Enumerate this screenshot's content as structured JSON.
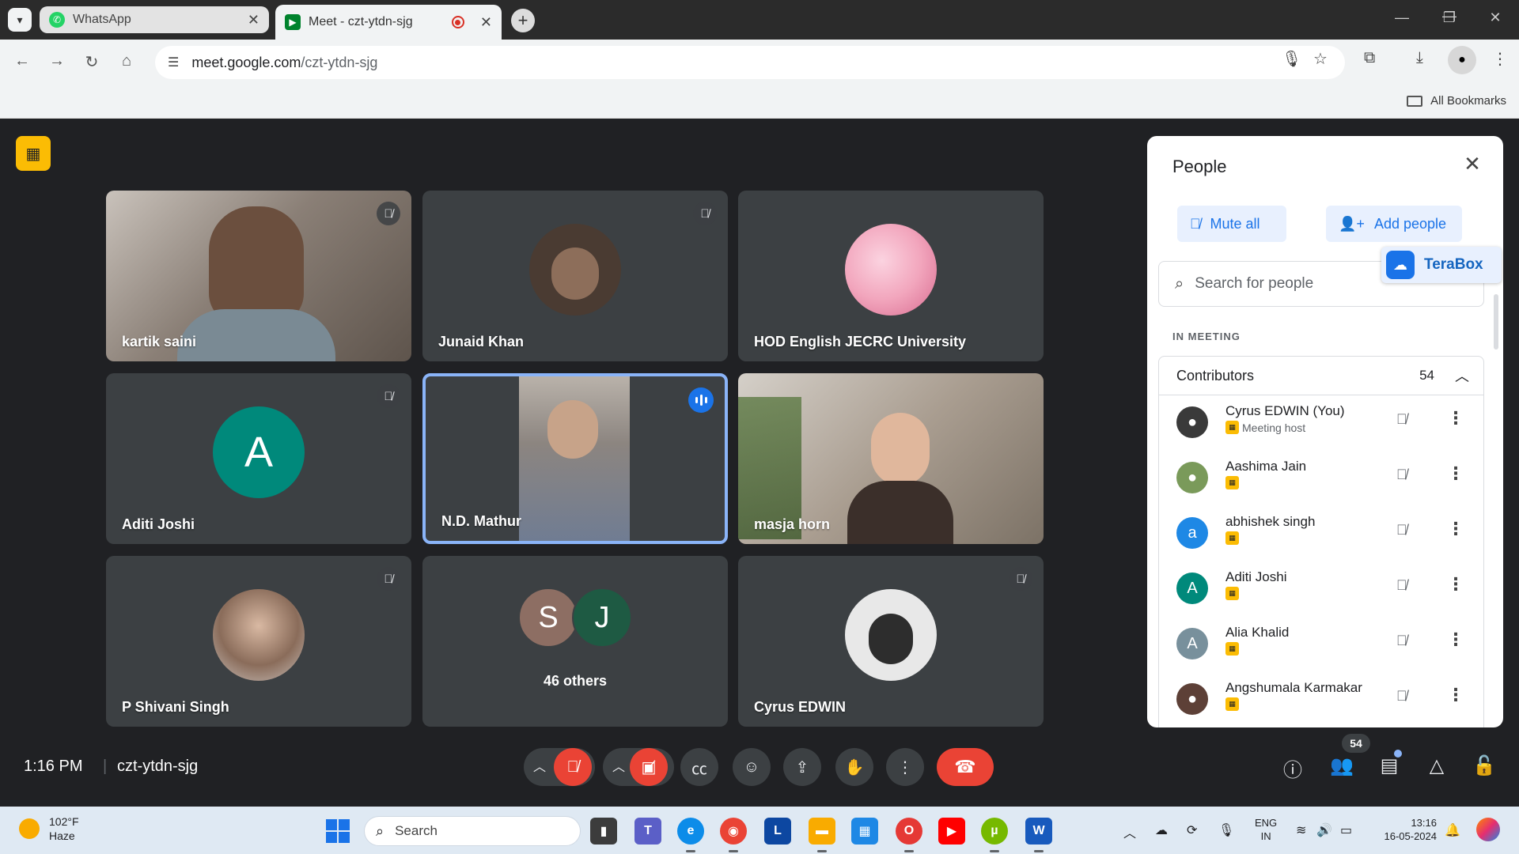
{
  "browser": {
    "tabs": [
      {
        "title": "WhatsApp",
        "active": false,
        "favicon": "whatsapp-icon",
        "color": "#25d366"
      },
      {
        "title": "Meet - czt-ytdn-sjg",
        "active": true,
        "favicon": "meet-icon",
        "color": "#00832d",
        "recording": true
      }
    ],
    "url_host": "meet.google.com",
    "url_path": "/czt-ytdn-sjg",
    "bookmarks_label": "All Bookmarks"
  },
  "tiles": [
    {
      "name": "kartik saini",
      "type": "video",
      "muted": true,
      "bg": "#8a7f76"
    },
    {
      "name": "Junaid Khan",
      "type": "avatar",
      "muted": true,
      "avatar_color": "#4a3b32",
      "avatar_letter": ""
    },
    {
      "name": "HOD English JECRC University",
      "type": "avatar",
      "muted": false,
      "avatar_color": "#f2a6bd",
      "avatar_letter": ""
    },
    {
      "name": "Aditi Joshi",
      "type": "avatar",
      "muted": true,
      "avatar_color": "#00897b",
      "avatar_letter": "A"
    },
    {
      "name": "N.D. Mathur",
      "type": "video",
      "muted": false,
      "speaking": true,
      "bg": "#6f6a66"
    },
    {
      "name": "masja horn",
      "type": "video",
      "muted": false,
      "bg": "#9a8d80"
    },
    {
      "name": "P Shivani Singh",
      "type": "avatar",
      "muted": true,
      "avatar_color": "#c9b6a8",
      "avatar_letter": ""
    },
    {
      "name": "",
      "type": "others",
      "muted": false,
      "others_label": "46 others"
    },
    {
      "name": "Cyrus EDWIN",
      "type": "avatar",
      "muted": true,
      "avatar_color": "#e8e8e8",
      "avatar_letter": ""
    }
  ],
  "others": {
    "label": "46 others",
    "avatars": [
      {
        "letter": "S",
        "color": "#8d6e63"
      },
      {
        "letter": "J",
        "color": "#1e5a43"
      }
    ]
  },
  "people_panel": {
    "title": "People",
    "mute_all_label": "Mute all",
    "add_people_label": "Add people",
    "terabox_label": "TeraBox",
    "search_placeholder": "Search for people",
    "section_label": "IN MEETING",
    "group_label": "Contributors",
    "group_count": "54",
    "participants": [
      {
        "name": "Cyrus EDWIN (You)",
        "role": "Meeting host",
        "avatar_letter": "",
        "avatar_color": "#3a3a3a"
      },
      {
        "name": "Aashima Jain",
        "role": "",
        "avatar_letter": "",
        "avatar_color": "#7a9a5a"
      },
      {
        "name": "abhishek singh",
        "role": "",
        "avatar_letter": "a",
        "avatar_color": "#1e88e5"
      },
      {
        "name": "Aditi Joshi",
        "role": "",
        "avatar_letter": "A",
        "avatar_color": "#00897b"
      },
      {
        "name": "Alia Khalid",
        "role": "",
        "avatar_letter": "A",
        "avatar_color": "#78909c"
      },
      {
        "name": "Angshumala Karmakar",
        "role": "",
        "avatar_letter": "",
        "avatar_color": "#5d4037"
      }
    ]
  },
  "controls": {
    "time": "1:16 PM",
    "separator": "|",
    "meeting_code": "czt-ytdn-sjg",
    "people_count": "54"
  },
  "taskbar": {
    "temperature": "102°F",
    "weather": "Haze",
    "search_label": "Search",
    "lang_line1": "ENG",
    "lang_line2": "IN",
    "clock_time": "13:16",
    "clock_date": "16-05-2024",
    "apps": [
      {
        "icon": "file-explorer-icon",
        "color": "#3c3c3c",
        "glyph": "▮"
      },
      {
        "icon": "teams-icon",
        "color": "#5b5fc7",
        "glyph": "T"
      },
      {
        "icon": "edge-icon",
        "color": "#0c8ce9",
        "glyph": "e"
      },
      {
        "icon": "chrome-icon",
        "color": "#ea4335",
        "glyph": "◉"
      },
      {
        "icon": "l-app-icon",
        "color": "#0d47a1",
        "glyph": "L"
      },
      {
        "icon": "folder-icon",
        "color": "#f9ab00",
        "glyph": "▬"
      },
      {
        "icon": "store-icon",
        "color": "#1e88e5",
        "glyph": "▦"
      },
      {
        "icon": "opera-icon",
        "color": "#e53935",
        "glyph": "O"
      },
      {
        "icon": "youtube-icon",
        "color": "#ff0000",
        "glyph": "▶"
      },
      {
        "icon": "utorrent-icon",
        "color": "#76b900",
        "glyph": "µ"
      },
      {
        "icon": "word-icon",
        "color": "#185abd",
        "glyph": "W"
      }
    ]
  }
}
